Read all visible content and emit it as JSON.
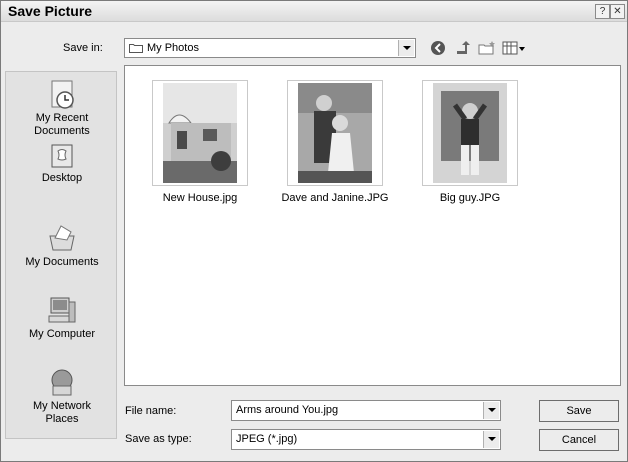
{
  "window": {
    "title": "Save Picture",
    "help_glyph": "?",
    "close_glyph": "✕"
  },
  "save_in": {
    "label": "Save in:",
    "value": "My Photos"
  },
  "places": [
    {
      "line1": "My Recent",
      "line2": "Documents"
    },
    {
      "line1": "Desktop",
      "line2": ""
    },
    {
      "line1": "My Documents",
      "line2": ""
    },
    {
      "line1": "My Computer",
      "line2": ""
    },
    {
      "line1": "My Network",
      "line2": "Places"
    }
  ],
  "files": [
    {
      "name": "New House.jpg"
    },
    {
      "name": "Dave and Janine.JPG"
    },
    {
      "name": "Big guy.JPG"
    }
  ],
  "file_name": {
    "label": "File name:",
    "value": "Arms around You.jpg"
  },
  "save_as_type": {
    "label": "Save as type:",
    "value": "JPEG (*.jpg)"
  },
  "buttons": {
    "save": "Save",
    "cancel": "Cancel"
  }
}
